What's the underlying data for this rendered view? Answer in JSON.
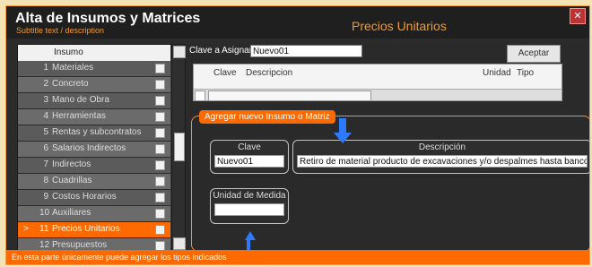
{
  "window": {
    "title": "Alta de Insumos y Matrices",
    "subtitle": "Subtitle text / description",
    "center_title": "Precios Unitarios"
  },
  "left_grid": {
    "header_label": "Insumo",
    "rows": [
      {
        "n": "1",
        "label": "Materiales"
      },
      {
        "n": "2",
        "label": "Concreto"
      },
      {
        "n": "3",
        "label": "Mano de Obra"
      },
      {
        "n": "4",
        "label": "Herramientas"
      },
      {
        "n": "5",
        "label": "Rentas y subcontratos"
      },
      {
        "n": "6",
        "label": "Salarios Indirectos"
      },
      {
        "n": "7",
        "label": "Indirectos"
      },
      {
        "n": "8",
        "label": "Cuadrillas"
      },
      {
        "n": "9",
        "label": "Costos Horarios"
      },
      {
        "n": "10",
        "label": "Auxiliares"
      },
      {
        "n": "11",
        "label": "Precios Unitarios",
        "selected": true
      },
      {
        "n": "12",
        "label": "Presupuestos"
      }
    ]
  },
  "top": {
    "clave_label": "Clave a Asignar",
    "clave_value": "Nuevo01",
    "accept_label": "Aceptar"
  },
  "table": {
    "headers": [
      "Clave",
      "Descripcion",
      "Unidad",
      "Tipo"
    ]
  },
  "group": {
    "tab_label": "Agregar nuevo Insumo o Matriz",
    "clave_label": "Clave",
    "clave_value": "Nuevo01",
    "desc_label": "Descripción",
    "desc_value": "Retiro de material producto de excavaciones y/o despalmes  hasta banco de tiro",
    "unidad_label": "Unidad de Medida",
    "unidad_value": ""
  },
  "statusbar": {
    "text": "En esta parte únicamente puede agregar los tipos indicados"
  },
  "colors": {
    "accent": "#ff6a00",
    "arrow": "#2c7bff"
  },
  "icons": {
    "close": "close-icon",
    "arrow_down": "arrow-down-icon",
    "arrow_up": "arrow-up-icon"
  }
}
